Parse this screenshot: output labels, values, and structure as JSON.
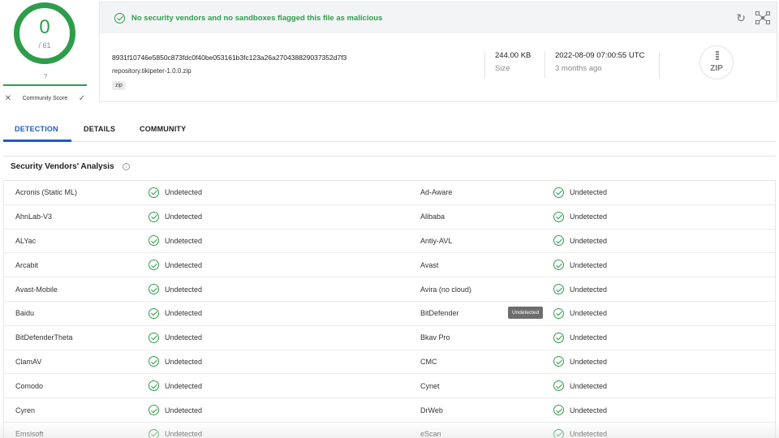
{
  "score": {
    "detections": "0",
    "total": "/ 61",
    "community_value": "?",
    "community_label": "Community Score",
    "detection_fraction": 0.0
  },
  "file": {
    "banner": "No security vendors and no sandboxes flagged this file as malicious",
    "hash": "8931f10746e5850c873fdc0f40be053161b3fc123a26a270438829037352d7f3",
    "name": "repository.tikipeter-1.0.0.zip",
    "tag": "zip",
    "size_value": "244.00 KB",
    "size_label": "Size",
    "date_value": "2022-08-09 07:00:55 UTC",
    "date_relative": "3 months ago",
    "type_icon_label": "ZIP",
    "icons": [
      "check-circle-icon",
      "refresh-icon",
      "graph-icon",
      "zip-file-icon"
    ]
  },
  "tabs": [
    "DETECTION",
    "DETAILS",
    "COMMUNITY"
  ],
  "active_tab": "DETECTION",
  "section_title": "Security Vendors' Analysis",
  "tooltip": "Undetected",
  "vendors": [
    {
      "left": {
        "name": "Acronis (Static ML)",
        "result": "Undetected"
      },
      "right": {
        "name": "Ad-Aware",
        "result": "Undetected"
      }
    },
    {
      "left": {
        "name": "AhnLab-V3",
        "result": "Undetected"
      },
      "right": {
        "name": "Alibaba",
        "result": "Undetected"
      }
    },
    {
      "left": {
        "name": "ALYac",
        "result": "Undetected"
      },
      "right": {
        "name": "Antiy-AVL",
        "result": "Undetected"
      }
    },
    {
      "left": {
        "name": "Arcabit",
        "result": "Undetected"
      },
      "right": {
        "name": "Avast",
        "result": "Undetected"
      }
    },
    {
      "left": {
        "name": "Avast-Mobile",
        "result": "Undetected"
      },
      "right": {
        "name": "Avira (no cloud)",
        "result": "Undetected"
      }
    },
    {
      "left": {
        "name": "Baidu",
        "result": "Undetected"
      },
      "right": {
        "name": "BitDefender",
        "result": "Undetected"
      }
    },
    {
      "left": {
        "name": "BitDefenderTheta",
        "result": "Undetected"
      },
      "right": {
        "name": "Bkav Pro",
        "result": "Undetected"
      }
    },
    {
      "left": {
        "name": "ClamAV",
        "result": "Undetected"
      },
      "right": {
        "name": "CMC",
        "result": "Undetected"
      }
    },
    {
      "left": {
        "name": "Comodo",
        "result": "Undetected"
      },
      "right": {
        "name": "Cynet",
        "result": "Undetected"
      }
    },
    {
      "left": {
        "name": "Cyren",
        "result": "Undetected"
      },
      "right": {
        "name": "DrWeb",
        "result": "Undetected"
      }
    },
    {
      "left": {
        "name": "Emsisoft",
        "result": "Undetected"
      },
      "right": {
        "name": "eScan",
        "result": "Undetected"
      }
    }
  ],
  "colors": {
    "accent_green": "#2e9d4b",
    "accent_blue": "#1f5bc6",
    "danger_red": "#e0625a"
  }
}
